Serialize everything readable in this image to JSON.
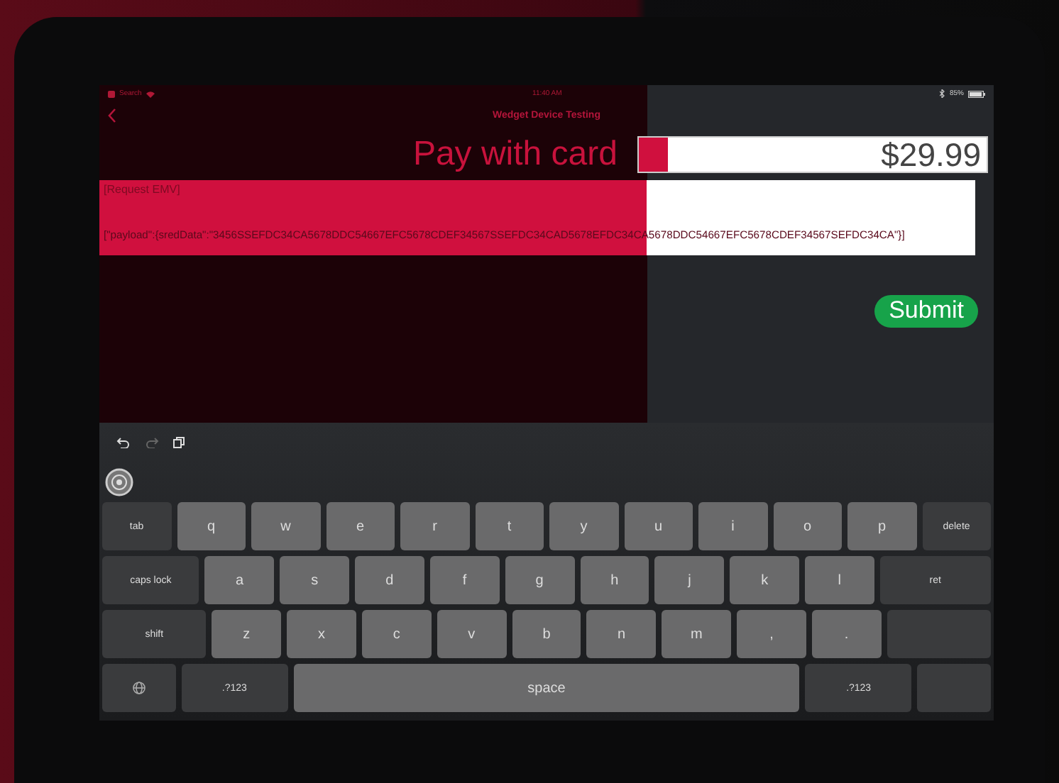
{
  "status_bar": {
    "back_app": "Search",
    "time": "11:40 AM",
    "battery": "85%"
  },
  "nav": {
    "title": "Wedget Device Testing"
  },
  "payment": {
    "label": "Pay with card",
    "amount": "$29.99"
  },
  "request": {
    "title": "[Request EMV]",
    "payload": "[\"payload\":{sredData\":\"3456SSEFDC34CA5678DDC54667EFC5678CDEF34567SSEFDC34CAD5678EFDC34CA5678DDC54667EFC5678CDEF34567SEFDC34CA\"}]"
  },
  "submit": {
    "label": "Submit"
  },
  "keyboard": {
    "rows": [
      {
        "keys": [
          {
            "label": "tab",
            "kind": "tab"
          },
          {
            "label": "q",
            "kind": "letter"
          },
          {
            "label": "w",
            "kind": "letter"
          },
          {
            "label": "e",
            "kind": "letter"
          },
          {
            "label": "r",
            "kind": "letter"
          },
          {
            "label": "t",
            "kind": "letter"
          },
          {
            "label": "y",
            "kind": "letter"
          },
          {
            "label": "u",
            "kind": "letter"
          },
          {
            "label": "i",
            "kind": "letter"
          },
          {
            "label": "o",
            "kind": "letter"
          },
          {
            "label": "p",
            "kind": "letter"
          },
          {
            "label": "delete",
            "kind": "delete"
          }
        ]
      },
      {
        "keys": [
          {
            "label": "caps lock",
            "kind": "caps"
          },
          {
            "label": "a",
            "kind": "letter"
          },
          {
            "label": "s",
            "kind": "letter"
          },
          {
            "label": "d",
            "kind": "letter"
          },
          {
            "label": "f",
            "kind": "letter"
          },
          {
            "label": "g",
            "kind": "letter"
          },
          {
            "label": "h",
            "kind": "letter"
          },
          {
            "label": "j",
            "kind": "letter"
          },
          {
            "label": "k",
            "kind": "letter"
          },
          {
            "label": "l",
            "kind": "letter"
          },
          {
            "label": "ret",
            "kind": "return"
          }
        ]
      },
      {
        "keys": [
          {
            "label": "shift",
            "kind": "shift"
          },
          {
            "label": "z",
            "kind": "letter"
          },
          {
            "label": "x",
            "kind": "letter"
          },
          {
            "label": "c",
            "kind": "letter"
          },
          {
            "label": "v",
            "kind": "letter"
          },
          {
            "label": "b",
            "kind": "letter"
          },
          {
            "label": "n",
            "kind": "letter"
          },
          {
            "label": "m",
            "kind": "letter"
          },
          {
            "label": ",",
            "kind": "letter"
          },
          {
            "label": ".",
            "kind": "letter"
          },
          {
            "kind": "shift"
          }
        ]
      },
      {
        "keys": [
          {
            "kind": "globe"
          },
          {
            "label": ".?123",
            "kind": "numbers"
          },
          {
            "label": "space",
            "kind": "space"
          },
          {
            "label": ".?123",
            "kind": "numbers"
          },
          {
            "kind": "globe_end"
          }
        ]
      }
    ]
  }
}
